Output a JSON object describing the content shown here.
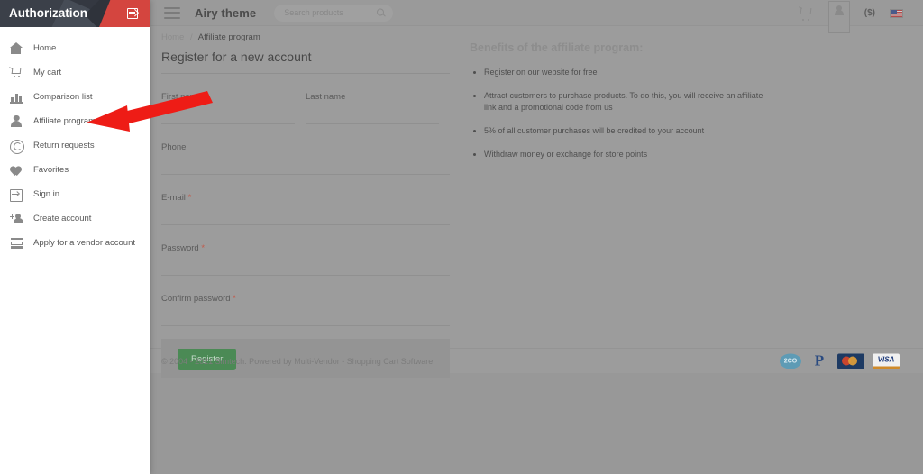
{
  "overlay": {
    "title": "Authorization",
    "login_icon": "login-icon",
    "nav_items": [
      {
        "label": "Home",
        "icon": "home-icon"
      },
      {
        "label": "My cart",
        "icon": "cart-icon"
      },
      {
        "label": "Comparison list",
        "icon": "bar-chart-icon"
      },
      {
        "label": "Affiliate program",
        "icon": "person-icon"
      },
      {
        "label": "Return requests",
        "icon": "return-circle-icon"
      },
      {
        "label": "Favorites",
        "icon": "heart-icon"
      },
      {
        "label": "Sign in",
        "icon": "sign-in-icon"
      },
      {
        "label": "Create account",
        "icon": "add-person-icon"
      },
      {
        "label": "Apply for a vendor account",
        "icon": "vendor-store-icon"
      }
    ]
  },
  "header": {
    "menu_icon": "hamburger-icon",
    "brand": "Airy theme",
    "search": {
      "placeholder": "Search products",
      "value": "",
      "icon": "search-icon"
    },
    "cart_icon": "cart-icon",
    "account_icon": "person-icon",
    "currency": "($)",
    "language_flag": "us-flag-icon"
  },
  "breadcrumb": {
    "home": "Home",
    "separator": "/",
    "current": "Affiliate program"
  },
  "form": {
    "title": "Register for a new account",
    "fields": [
      {
        "label": "First name",
        "required": "",
        "value": "",
        "width": "half"
      },
      {
        "label": "Last name",
        "required": "",
        "value": "",
        "width": "half"
      },
      {
        "label": "Phone",
        "required": "",
        "value": "",
        "width": "full"
      },
      {
        "label": "E-mail",
        "required": "*",
        "value": "",
        "width": "full"
      },
      {
        "label": "Password",
        "required": "*",
        "value": "",
        "width": "full"
      },
      {
        "label": "Confirm password",
        "required": "*",
        "value": "",
        "width": "full"
      }
    ],
    "submit_label": "Register",
    "submit_color": "#4b8a55"
  },
  "benefits": {
    "heading": "Benefits of the affiliate program:",
    "items": [
      "Register on our website for free",
      "Attract customers to purchase products. To do this, you will receive an affiliate link and a promotional code from us",
      "5% of all customer purchases will be credited to your account",
      "Withdraw money or exchange for store points"
    ]
  },
  "footer": {
    "copyright": "© 2004 - 2021 Simtech.  Powered by Multi-Vendor - Shopping Cart Software",
    "payment_icons": [
      {
        "name": "2co-icon",
        "label": "2CO"
      },
      {
        "name": "paypal-icon",
        "label": "P"
      },
      {
        "name": "mastercard-icon",
        "label": "MasterCard"
      },
      {
        "name": "visa-icon",
        "label": "VISA"
      }
    ]
  },
  "annotation": {
    "arrow_color": "#ee1c16",
    "points_to": "Affiliate program"
  }
}
